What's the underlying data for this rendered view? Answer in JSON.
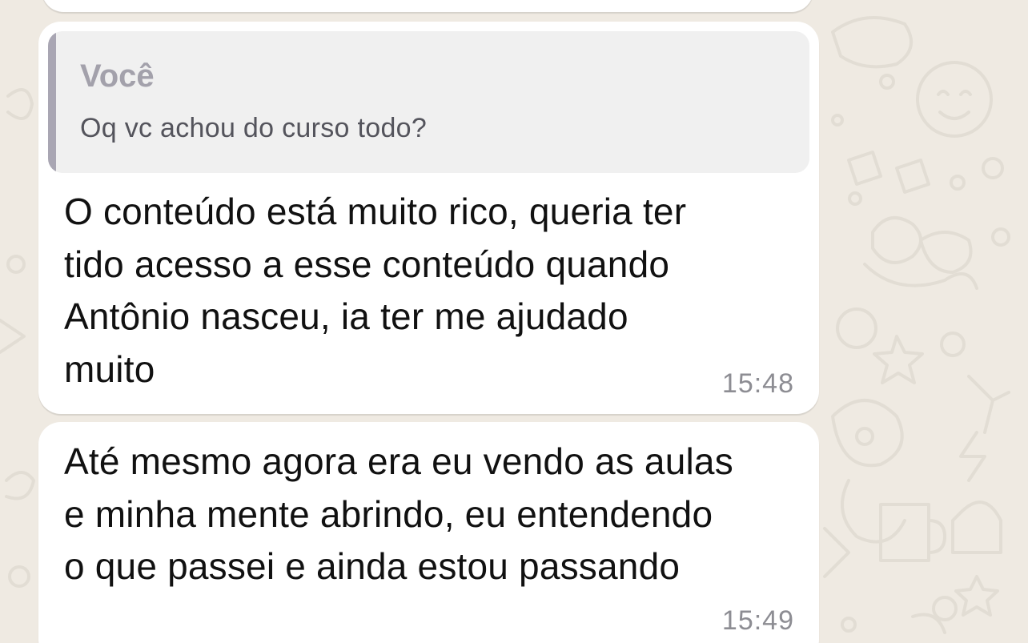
{
  "chat": {
    "messages": [
      {
        "quoted": {
          "author": "Você",
          "text": "Oq vc achou do curso todo?"
        },
        "lines": [
          "O conteúdo está muito rico, queria ter",
          "tido acesso a esse conteúdo quando",
          "Antônio nasceu, ia ter me ajudado",
          "muito"
        ],
        "time": "15:48"
      },
      {
        "lines": [
          "Até mesmo agora era eu vendo as aulas",
          "e minha mente abrindo, eu entendendo",
          "o que passei e ainda estou passando"
        ],
        "time": "15:49"
      }
    ]
  },
  "colors": {
    "background": "#efeae2",
    "bubble": "#ffffff",
    "quote_background": "#f0f0f0",
    "quote_bar": "#a9a6b3"
  }
}
